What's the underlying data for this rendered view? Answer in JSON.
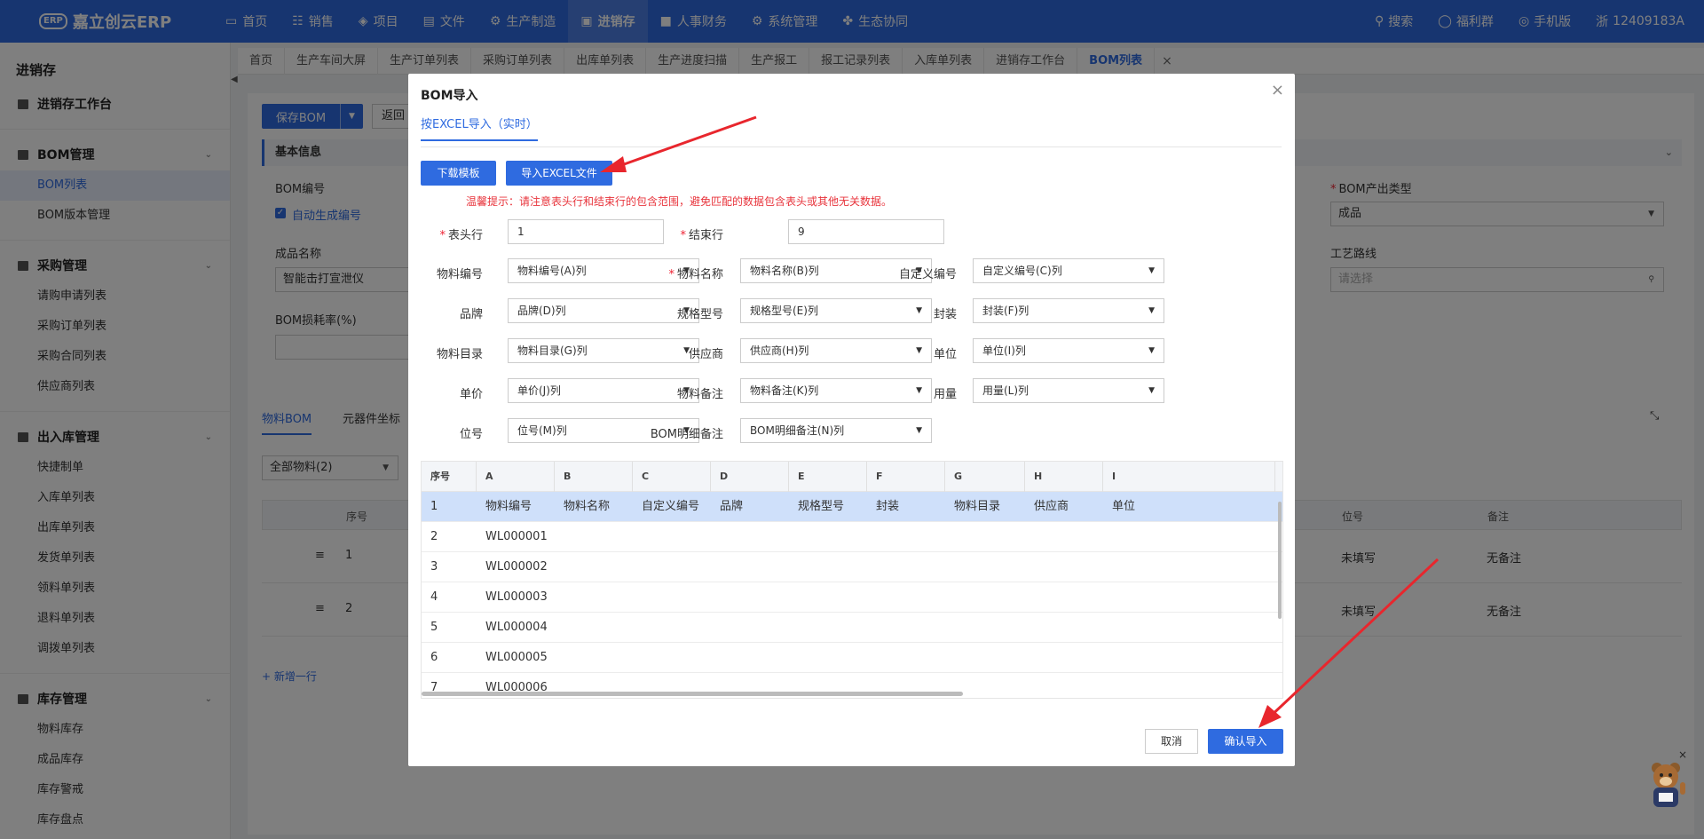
{
  "topbar": {
    "brand": "嘉立创云ERP",
    "brand_badge": "ERP",
    "nav": [
      {
        "label": "首页",
        "icon": "monitor-icon"
      },
      {
        "label": "销售",
        "icon": "cart-icon"
      },
      {
        "label": "项目",
        "icon": "layers-icon"
      },
      {
        "label": "文件",
        "icon": "folder-icon"
      },
      {
        "label": "生产制造",
        "icon": "gear-box-icon"
      },
      {
        "label": "进销存",
        "icon": "box-icon"
      },
      {
        "label": "人事财务",
        "icon": "id-card-icon"
      },
      {
        "label": "系统管理",
        "icon": "settings-icon"
      },
      {
        "label": "生态协同",
        "icon": "cluster-icon"
      }
    ],
    "active_nav": "进销存",
    "right": {
      "search": "搜索",
      "welfare": "福利群",
      "mobile": "手机版",
      "province": "浙",
      "account": "12409183A"
    }
  },
  "sidebar": {
    "title": "进销存",
    "workbench": "进销存工作台",
    "sections": [
      {
        "label": "BOM管理",
        "items": [
          "BOM列表",
          "BOM版本管理"
        ]
      },
      {
        "label": "采购管理",
        "items": [
          "请购申请列表",
          "采购订单列表",
          "采购合同列表",
          "供应商列表"
        ]
      },
      {
        "label": "出入库管理",
        "items": [
          "快捷制单",
          "入库单列表",
          "出库单列表",
          "发货单列表",
          "领料单列表",
          "退料单列表",
          "调拨单列表"
        ]
      },
      {
        "label": "库存管理",
        "items": [
          "物料库存",
          "成品库存",
          "库存警戒",
          "库存盘点"
        ]
      }
    ],
    "active_item": "BOM列表"
  },
  "tabs": [
    "首页",
    "生产车间大屏",
    "生产订单列表",
    "采购订单列表",
    "出库单列表",
    "生产进度扫描",
    "生产报工",
    "报工记录列表",
    "入库单列表",
    "进销存工作台",
    "BOM列表"
  ],
  "active_tab": "BOM列表",
  "page": {
    "save_label": "保存BOM",
    "back_label": "返回",
    "section_basic": "基本信息",
    "bom_no_label": "BOM编号",
    "auto_gen_label": "自动生成编号",
    "product_name_label": "成品名称",
    "product_name_value": "智能击打宣泄仪",
    "loss_rate_label": "BOM损耗率(%)",
    "output_type_label": "BOM产出类型",
    "output_type_value": "成品",
    "route_label": "工艺路线",
    "route_placeholder": "请选择",
    "tab_material": "物料BOM",
    "tab_coord": "元器件坐标",
    "filter_value": "全部物料(2)",
    "col_seq": "序号",
    "col_position": "位号",
    "col_remark": "备注",
    "rows": [
      {
        "seq": "1",
        "position": "未填写",
        "remark": "无备注"
      },
      {
        "seq": "2",
        "position": "未填写",
        "remark": "无备注"
      }
    ],
    "add_row": "+ 新增一行"
  },
  "dialog": {
    "title": "BOM导入",
    "tab": "按EXCEL导入（实时）",
    "download_template": "下载模板",
    "import_excel": "导入EXCEL文件",
    "hint": "温馨提示：请注意表头行和结束行的包含范围，避免匹配的数据包含表头或其他无关数据。",
    "header_row_label": "表头行",
    "header_row_value": "1",
    "end_row_label": "结束行",
    "end_row_value": "9",
    "mappings": [
      {
        "label": "物料编号",
        "value": "物料编号(A)列",
        "required": false
      },
      {
        "label": "物料名称",
        "value": "物料名称(B)列",
        "required": true
      },
      {
        "label": "自定义编号",
        "value": "自定义编号(C)列",
        "required": false
      },
      {
        "label": "品牌",
        "value": "品牌(D)列",
        "required": false
      },
      {
        "label": "规格型号",
        "value": "规格型号(E)列",
        "required": false
      },
      {
        "label": "封装",
        "value": "封装(F)列",
        "required": false
      },
      {
        "label": "物料目录",
        "value": "物料目录(G)列",
        "required": false
      },
      {
        "label": "供应商",
        "value": "供应商(H)列",
        "required": false
      },
      {
        "label": "单位",
        "value": "单位(I)列",
        "required": false
      },
      {
        "label": "单价",
        "value": "单价(J)列",
        "required": false
      },
      {
        "label": "物料备注",
        "value": "物料备注(K)列",
        "required": false
      },
      {
        "label": "用量",
        "value": "用量(L)列",
        "required": false
      },
      {
        "label": "位号",
        "value": "位号(M)列",
        "required": false
      },
      {
        "label": "BOM明细备注",
        "value": "BOM明细备注(N)列",
        "required": false
      }
    ],
    "grid": {
      "columns": [
        "序号",
        "A",
        "B",
        "C",
        "D",
        "E",
        "F",
        "G",
        "H",
        "I"
      ],
      "rows": [
        [
          "1",
          "物料编号",
          "物料名称",
          "自定义编号",
          "品牌",
          "规格型号",
          "封装",
          "物料目录",
          "供应商",
          "单位"
        ],
        [
          "2",
          "WL000001",
          "",
          "",
          "",
          "",
          "",
          "",
          "",
          ""
        ],
        [
          "3",
          "WL000002",
          "",
          "",
          "",
          "",
          "",
          "",
          "",
          ""
        ],
        [
          "4",
          "WL000003",
          "",
          "",
          "",
          "",
          "",
          "",
          "",
          ""
        ],
        [
          "5",
          "WL000004",
          "",
          "",
          "",
          "",
          "",
          "",
          "",
          ""
        ],
        [
          "6",
          "WL000005",
          "",
          "",
          "",
          "",
          "",
          "",
          "",
          ""
        ],
        [
          "7",
          "WL000006",
          "",
          "",
          "",
          "",
          "",
          "",
          "",
          ""
        ]
      ],
      "selected_row": 0
    },
    "cancel": "取消",
    "confirm": "确认导入"
  },
  "colors": {
    "primary": "#2f6be0",
    "hint_red": "#e8343c",
    "arrow_red": "#e8262d",
    "selected_row": "#cfe0fa"
  }
}
